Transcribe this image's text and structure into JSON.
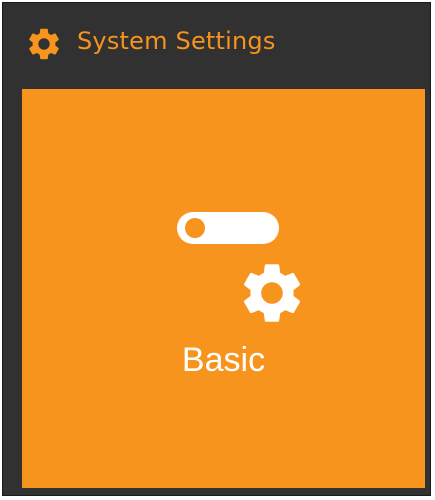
{
  "header": {
    "title": "System Settings",
    "icon": "gear-icon",
    "accent_color": "#f7941d"
  },
  "tile": {
    "label": "Basic",
    "background_color": "#f7941d",
    "icons": [
      "toggle-switch-icon",
      "gear-icon"
    ]
  },
  "colors": {
    "panel_background": "#313131",
    "tile_background": "#f7941d",
    "tile_text": "#ffffff"
  }
}
